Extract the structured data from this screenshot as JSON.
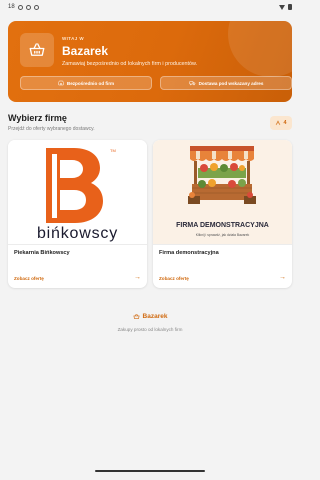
{
  "status_bar": {
    "time": "18"
  },
  "hero": {
    "welcome": "WITAJ W",
    "title": "Bazarek",
    "subtitle": "Zamawiaj bezpośrednio od lokalnych firm i producentów.",
    "pill_1": "Bezpośrednio od firm",
    "pill_2": "Dostawa pod wskazany adres"
  },
  "section": {
    "title": "Wybierz firmę",
    "subtitle": "Przejdź do oferty wybranego dostawcy.",
    "count": "4"
  },
  "cards": [
    {
      "name": "Piekarnia Bińkowscy",
      "cta": "Zobacz ofertę",
      "logo_text": "bińkowscy",
      "logo_mark": "TM"
    },
    {
      "name": "Firma demonstracyjna",
      "cta": "Zobacz ofertę",
      "banner_title": "FIRMA DEMONSTRACYJNA",
      "banner_sub": "Kliknij i sprawdź, jak działa Bazarek"
    }
  ],
  "footer": {
    "brand": "Bazarek",
    "tagline": "Zakupy prosto od lokalnych firm"
  },
  "colors": {
    "accent": "#dc6a0c",
    "accent_light": "#fbe6cf",
    "background": "#f3f3f3"
  }
}
